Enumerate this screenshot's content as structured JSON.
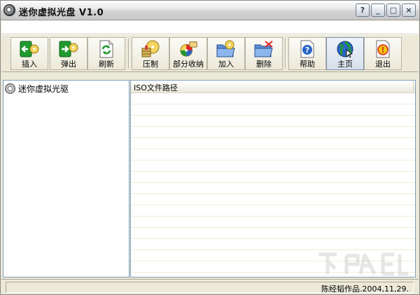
{
  "window": {
    "title": "迷你虚拟光盘 V1.0",
    "controls": {
      "minimize": "_",
      "maximize": "□",
      "close": "×"
    }
  },
  "toolbar": {
    "buttons": [
      {
        "label": "插入",
        "icon": "insert-disc-icon"
      },
      {
        "label": "弹出",
        "icon": "eject-disc-icon"
      },
      {
        "label": "刷新",
        "icon": "refresh-icon"
      },
      {
        "label": "压制",
        "icon": "compress-disc-icon"
      },
      {
        "label": "部分收纳",
        "icon": "partial-collect-icon"
      },
      {
        "label": "加入",
        "icon": "add-folder-icon"
      },
      {
        "label": "删除",
        "icon": "delete-folder-icon"
      },
      {
        "label": "帮助",
        "icon": "help-icon"
      },
      {
        "label": "主页",
        "icon": "home-globe-icon"
      },
      {
        "label": "退出",
        "icon": "exit-icon"
      }
    ]
  },
  "tree": {
    "root_label": "迷你虚拟光驱"
  },
  "list": {
    "columns": [
      "ISO文件路径"
    ]
  },
  "statusbar": {
    "text": "陈经韬作品.2004,11,29."
  },
  "colors": {
    "green": "#1f9a2f",
    "blue": "#2a64c5",
    "yellow": "#f1c40f",
    "red": "#d22"
  }
}
